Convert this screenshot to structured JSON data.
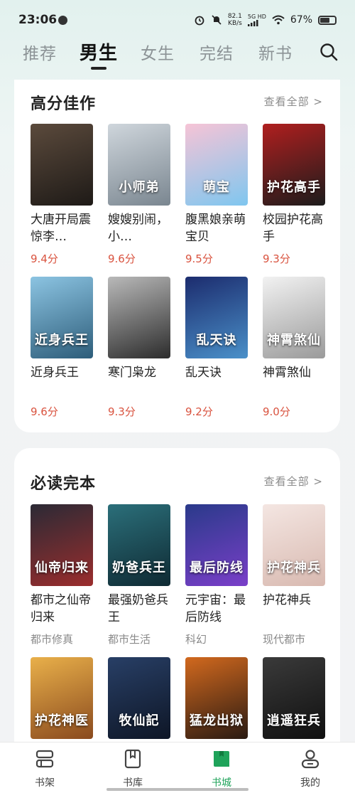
{
  "status": {
    "time": "23:06",
    "net_speed_value": "82.1",
    "net_speed_unit": "KB/s",
    "signal_label": "5G HD",
    "battery": "67%",
    "battery_level": 0.67
  },
  "tabs": [
    {
      "label": "推荐"
    },
    {
      "label": "男生"
    },
    {
      "label": "女生"
    },
    {
      "label": "完结"
    },
    {
      "label": "新书"
    }
  ],
  "active_tab": "男生",
  "sections": [
    {
      "title": "高分佳作",
      "more_label": "查看全部 >",
      "books": [
        {
          "title": "大唐开局震惊李…",
          "meta": "9.4分",
          "cover_text": "",
          "cover_colors": [
            "#5b4a3c",
            "#1e1a17"
          ]
        },
        {
          "title": "嫂嫂别闹，小…",
          "meta": "9.6分",
          "cover_text": "小师弟",
          "cover_colors": [
            "#cfd6dc",
            "#7a8690"
          ]
        },
        {
          "title": "腹黑娘亲萌宝贝",
          "meta": "9.5分",
          "cover_text": "萌宝",
          "cover_colors": [
            "#f6c4d6",
            "#7fc6ef"
          ]
        },
        {
          "title": "校园护花高手",
          "meta": "9.3分",
          "cover_text": "护花高手",
          "cover_colors": [
            "#b01f1f",
            "#1c1c1c"
          ]
        },
        {
          "title": "近身兵王",
          "meta": "9.6分",
          "cover_text": "近身兵王",
          "cover_colors": [
            "#8cc4e2",
            "#2d5d7a"
          ]
        },
        {
          "title": "寒门枭龙",
          "meta": "9.3分",
          "cover_text": "",
          "cover_colors": [
            "#b9b9b9",
            "#2c2c2c"
          ]
        },
        {
          "title": "乱天诀",
          "meta": "9.2分",
          "cover_text": "乱天诀",
          "cover_colors": [
            "#1c2c6e",
            "#4a90c9"
          ]
        },
        {
          "title": "神霄煞仙",
          "meta": "9.0分",
          "cover_text": "神霄煞仙",
          "cover_colors": [
            "#f2f2f2",
            "#9a9a9a"
          ]
        }
      ]
    },
    {
      "title": "必读完本",
      "more_label": "查看全部 >",
      "books": [
        {
          "title": "都市之仙帝归来",
          "meta": "都市修真",
          "cover_text": "仙帝归来",
          "cover_colors": [
            "#2b2a35",
            "#9b2d2d"
          ]
        },
        {
          "title": "最强奶爸兵王",
          "meta": "都市生活",
          "cover_text": "奶爸兵王",
          "cover_colors": [
            "#2b6f7a",
            "#0f2a33"
          ]
        },
        {
          "title": "元宇宙：最后防线",
          "meta": "科幻",
          "cover_text": "最后防线",
          "cover_colors": [
            "#2a3a8a",
            "#7a3fc9"
          ]
        },
        {
          "title": "护花神兵",
          "meta": "现代都市",
          "cover_text": "护花神兵",
          "cover_colors": [
            "#f4e6e2",
            "#d8b9b0"
          ]
        },
        {
          "title": "护花神医",
          "meta": "",
          "cover_text": "护花神医",
          "cover_colors": [
            "#e9b04a",
            "#8a4a1e"
          ]
        },
        {
          "title": "牧仙记",
          "meta": "",
          "cover_text": "牧仙記",
          "cover_colors": [
            "#283f66",
            "#0e1626"
          ]
        },
        {
          "title": "猛龙出狱",
          "meta": "",
          "cover_text": "猛龙出狱",
          "cover_colors": [
            "#d2691e",
            "#2a1a12"
          ]
        },
        {
          "title": "逍遥狂兵",
          "meta": "",
          "cover_text": "逍遥狂兵",
          "cover_colors": [
            "#3a3a3a",
            "#101010"
          ]
        }
      ]
    }
  ],
  "bottom_nav": [
    {
      "label": "书架",
      "icon": "bookshelf-icon"
    },
    {
      "label": "书库",
      "icon": "library-icon"
    },
    {
      "label": "书城",
      "icon": "bookstore-icon"
    },
    {
      "label": "我的",
      "icon": "profile-icon"
    }
  ],
  "active_nav": "书城",
  "colors": {
    "accent": "#1fa35a",
    "score": "#d9533f"
  }
}
